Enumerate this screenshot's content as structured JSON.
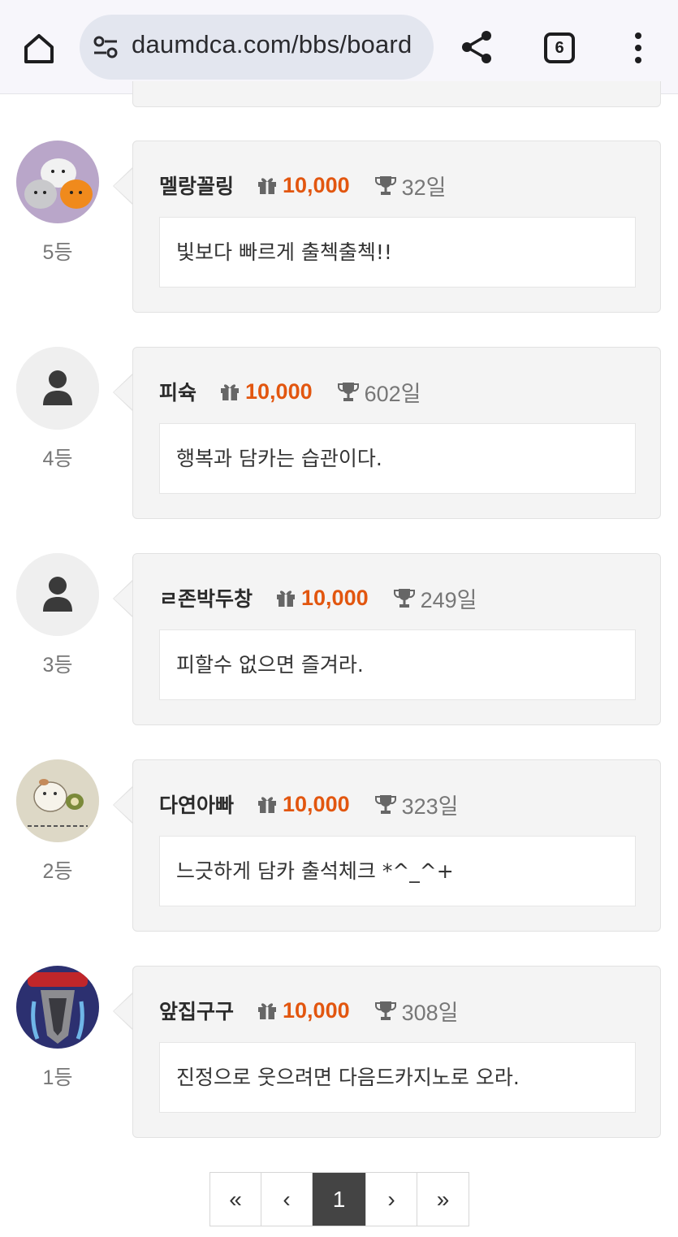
{
  "browser": {
    "url": "daumdca.com/bbs/board",
    "tab_count": "6",
    "icons": [
      "home-icon",
      "site-settings-icon",
      "share-icon",
      "tab-switcher-icon",
      "more-vert-icon"
    ]
  },
  "colors": {
    "accent_points": "#e2560f",
    "card_bg": "#f4f4f4",
    "active_page_bg": "#444444"
  },
  "entries": [
    {
      "nickname": "멜랑꼴링",
      "points": "10,000",
      "days": "32일",
      "message": "빛보다 빠르게 출첵출첵!!",
      "rank": "5등",
      "avatar": "seal-plush-avatar"
    },
    {
      "nickname": "피슉",
      "points": "10,000",
      "days": "602일",
      "message": "행복과 담카는 습관이다.",
      "rank": "4등",
      "avatar": "default-person-avatar"
    },
    {
      "nickname": "ㄹ존박두창",
      "points": "10,000",
      "days": "249일",
      "message": "피할수 없으면 즐겨라.",
      "rank": "3등",
      "avatar": "default-person-avatar"
    },
    {
      "nickname": "다연아빠",
      "points": "10,000",
      "days": "323일",
      "message": "느긋하게 담카 출석체크 *^_^+",
      "rank": "2등",
      "avatar": "hamster-sketch-avatar"
    },
    {
      "nickname": "앞집구구",
      "points": "10,000",
      "days": "308일",
      "message": "진정으로 웃으려면 다음드카지노로 오라.",
      "rank": "1등",
      "avatar": "crying-bird-avatar"
    }
  ],
  "pagination": {
    "first": "«",
    "prev": "‹",
    "current": "1",
    "next": "›",
    "last": "»"
  }
}
